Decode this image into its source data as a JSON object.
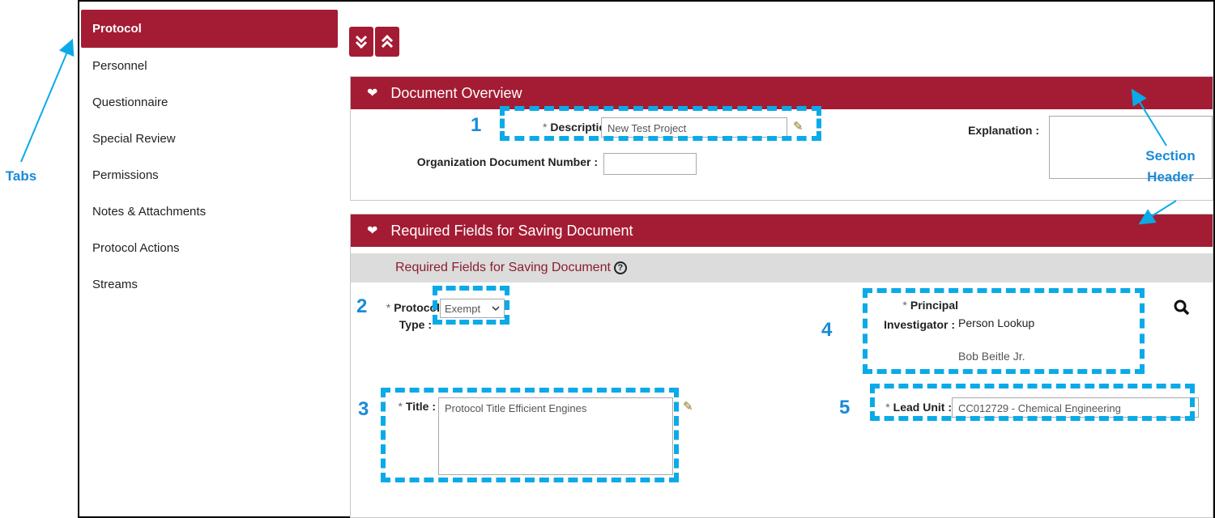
{
  "tabs": [
    {
      "label": "Protocol",
      "active": true
    },
    {
      "label": "Personnel"
    },
    {
      "label": "Questionnaire"
    },
    {
      "label": "Special Review"
    },
    {
      "label": "Permissions"
    },
    {
      "label": "Notes & Attachments"
    },
    {
      "label": "Protocol Actions"
    },
    {
      "label": "Streams"
    }
  ],
  "toolbar": {
    "collapse_all_glyph": "⬇",
    "expand_all_glyph": "⬆"
  },
  "document_overview": {
    "header": "Document Overview",
    "description_label": "Description :",
    "description_value": "New Test Project",
    "explanation_label": "Explanation :",
    "explanation_value": "",
    "org_doc_number_label": "Organization Document Number :",
    "org_doc_number_value": ""
  },
  "required_fields": {
    "header": "Required Fields for Saving Document",
    "subheader": "Required Fields for Saving Document",
    "protocol_type_label_1": "Protocol",
    "protocol_type_label_2": "Type :",
    "protocol_type_value": "Exempt",
    "title_label": "Title :",
    "title_value": "Protocol Title Efficient Engines",
    "pi_label_1": "Principal",
    "pi_label_2": "Investigator :",
    "pi_lookup": "Person Lookup",
    "pi_name": "Bob Beitle Jr.",
    "lead_unit_label": "Lead Unit :",
    "lead_unit_value": "CC012729 - Chemical Engineering"
  },
  "annotations": {
    "tabs_label": "Tabs",
    "section_label_1": "Section",
    "section_label_2": "Header",
    "n1": "1",
    "n2": "2",
    "n3": "3",
    "n4": "4",
    "n5": "5",
    "color": "#0aaae8"
  },
  "colors": {
    "accent": "#a31c33",
    "subbar": "#dcdcdc"
  },
  "icons": {
    "star": "*"
  }
}
